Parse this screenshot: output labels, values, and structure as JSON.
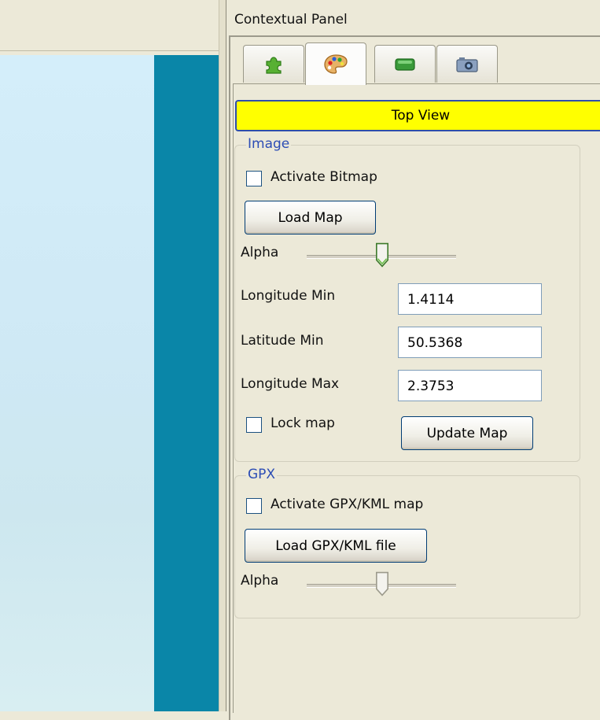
{
  "panel": {
    "title": "Contextual Panel",
    "tabs": [
      {
        "icon": "puzzle-icon",
        "active": false
      },
      {
        "icon": "palette-icon",
        "active": true
      },
      {
        "icon": "layer-icon",
        "active": false
      },
      {
        "icon": "camera-icon",
        "active": false
      }
    ],
    "view_label": "Top View",
    "colors": {
      "view_bar": "#ffff00",
      "group_legend": "#2c4db5",
      "map_strip": "#0a86a8"
    }
  },
  "image_group": {
    "legend": "Image",
    "activate_bitmap_label": "Activate Bitmap",
    "activate_bitmap_checked": false,
    "load_map_label": "Load Map",
    "alpha_label": "Alpha",
    "alpha_value_fraction": 0.5,
    "longitude_min_label": "Longitude Min",
    "longitude_min_value": "1.4114",
    "latitude_min_label": "Latitude Min",
    "latitude_min_value": "50.5368",
    "longitude_max_label": "Longitude Max",
    "longitude_max_value": "2.3753",
    "lock_map_label": "Lock map",
    "lock_map_checked": false,
    "update_map_label": "Update Map"
  },
  "gpx_group": {
    "legend": "GPX",
    "activate_gpx_label": "Activate GPX/KML map",
    "activate_gpx_checked": false,
    "load_gpx_label": "Load GPX/KML file",
    "alpha_label": "Alpha",
    "alpha_value_fraction": 0.5
  }
}
